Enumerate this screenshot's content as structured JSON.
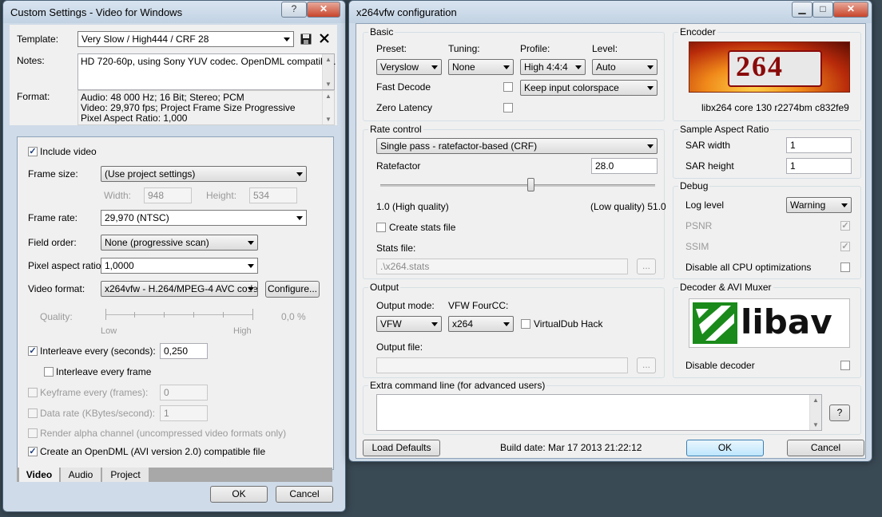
{
  "left_window": {
    "title": "Custom Settings - Video for Windows",
    "help_btn": "?",
    "close_btn": "✕",
    "template_label": "Template:",
    "template_value": "Very Slow / High444 / CRF 28",
    "notes_label": "Notes:",
    "notes_value": "HD 720-60p, using Sony YUV codec. OpenDML compatible.",
    "format_label": "Format:",
    "format_lines": [
      "Audio: 48 000 Hz; 16 Bit; Stereo; PCM",
      "Video: 29,970 fps; Project Frame Size Progressive",
      "Pixel Aspect Ratio: 1,000"
    ],
    "include_video": "Include video",
    "frame_size_label": "Frame size:",
    "frame_size_value": "(Use project settings)",
    "width_label": "Width:",
    "width_value": "948",
    "height_label": "Height:",
    "height_value": "534",
    "frame_rate_label": "Frame rate:",
    "frame_rate_value": "29,970 (NTSC)",
    "field_order_label": "Field order:",
    "field_order_value": "None (progressive scan)",
    "par_label": "Pixel aspect ratio:",
    "par_value": "1,0000",
    "video_format_label": "Video format:",
    "video_format_value": "x264vfw - H.264/MPEG-4 AVC codec",
    "configure_btn": "Configure...",
    "quality_label": "Quality:",
    "quality_low": "Low",
    "quality_high": "High",
    "quality_value": "0,0 %",
    "interleave_label": "Interleave every (seconds):",
    "interleave_value": "0,250",
    "interleave_frame": "Interleave every frame",
    "keyframe_label": "Keyframe every (frames):",
    "keyframe_value": "0",
    "datarate_label": "Data rate (KBytes/second):",
    "datarate_value": "1",
    "alpha_label": "Render alpha channel (uncompressed video formats only)",
    "opendml_label": "Create an OpenDML (AVI version 2.0) compatible file",
    "tabs": [
      "Video",
      "Audio",
      "Project"
    ],
    "ok_btn": "OK",
    "cancel_btn": "Cancel"
  },
  "right_window": {
    "title": "x264vfw configuration",
    "basic_group": "Basic",
    "preset_label": "Preset:",
    "preset_value": "Veryslow",
    "tuning_label": "Tuning:",
    "tuning_value": "None",
    "profile_label": "Profile:",
    "profile_value": "High 4:4:4",
    "level_label": "Level:",
    "level_value": "Auto",
    "fast_decode": "Fast Decode",
    "zero_latency": "Zero Latency",
    "colorspace_value": "Keep input colorspace",
    "encoder_group": "Encoder",
    "logo_text": "264",
    "encoder_version": "libx264 core 130 r2274bm c832fe9",
    "rate_group": "Rate control",
    "rate_mode": "Single pass - ratefactor-based (CRF)",
    "ratefactor_label": "Ratefactor",
    "ratefactor_value": "28.0",
    "ratefactor_slider_fraction": 0.55,
    "rf_low_label": "1.0 (High quality)",
    "rf_high_label": "(Low quality) 51.0",
    "create_stats": "Create stats file",
    "stats_file_label": "Stats file:",
    "stats_file_value": ".\\x264.stats",
    "browse_btn": "...",
    "sar_group": "Sample Aspect Ratio",
    "sar_width_label": "SAR width",
    "sar_width_value": "1",
    "sar_height_label": "SAR height",
    "sar_height_value": "1",
    "debug_group": "Debug",
    "log_level_label": "Log level",
    "log_level_value": "Warning",
    "psnr": "PSNR",
    "ssim": "SSIM",
    "disable_cpu": "Disable all CPU optimizations",
    "output_group": "Output",
    "output_mode_label": "Output mode:",
    "output_mode_value": "VFW",
    "fourcc_label": "VFW FourCC:",
    "fourcc_value": "x264",
    "vdub_hack": "VirtualDub Hack",
    "output_file_label": "Output file:",
    "decoder_group": "Decoder & AVI Muxer",
    "libav_text": "libav",
    "disable_decoder": "Disable decoder",
    "extra_group": "Extra command line (for advanced users)",
    "help_q": "?",
    "load_defaults": "Load Defaults",
    "build_date": "Build date: Mar 17 2013 21:22:12",
    "ok_btn": "OK",
    "cancel_btn": "Cancel"
  }
}
